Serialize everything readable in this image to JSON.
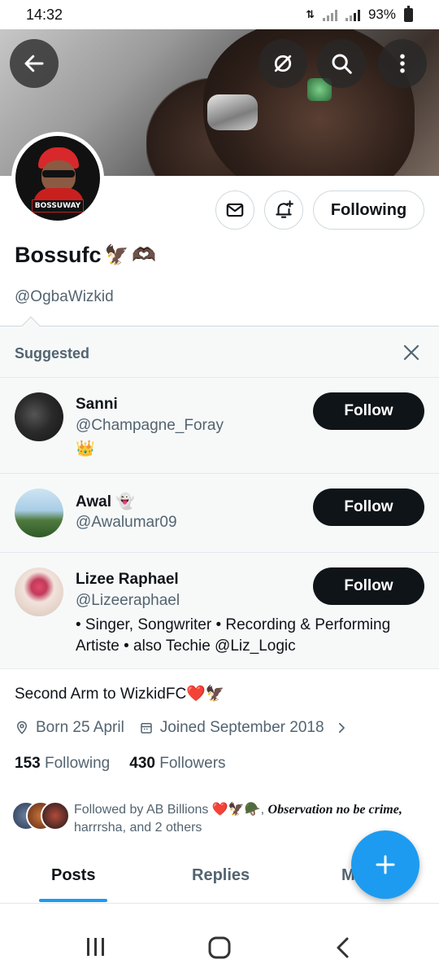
{
  "status_bar": {
    "time": "14:32",
    "battery": "93%",
    "icons": [
      "data-transfer-icon",
      "signal-icon",
      "signal-icon",
      "battery-icon"
    ]
  },
  "banner": {
    "buttons": [
      "back-arrow-icon",
      "hide-icon",
      "search-icon",
      "more-vertical-icon"
    ]
  },
  "profile": {
    "avatar_text": "BOSSUWAY",
    "name": "Bossufc",
    "name_emojis": [
      "🦅",
      "🫶🏿"
    ],
    "handle": "@OgbaWizkid",
    "following_button": "Following",
    "bio": "Second Arm to WizkidFC❤️🦅",
    "born": "Born 25 April",
    "joined": "Joined September 2018",
    "following_count": "153",
    "following_label": "Following",
    "followers_count": "430",
    "followers_label": "Followers",
    "followed_by_prefix": "Followed by AB Billions ❤️🦅🪖,",
    "followed_by_fancy": "Observation no be crime,",
    "followed_by_suffix": "harrrsha, and 2 others"
  },
  "suggested": {
    "title": "Suggested",
    "items": [
      {
        "name": "Sanni",
        "handle": "@Champagne_Foray",
        "bio": "👑",
        "button": "Follow"
      },
      {
        "name": "Awal 👻",
        "handle": "@Awalumar09",
        "bio": "",
        "button": "Follow"
      },
      {
        "name": "Lizee Raphael",
        "handle": "@Lizeeraphael",
        "bio": "• Singer, Songwriter • Recording & Performing Artiste  • also Techie @Liz_Logic",
        "button": "Follow"
      }
    ]
  },
  "tabs": {
    "posts": "Posts",
    "replies": "Replies",
    "media_partial": "M"
  },
  "colors": {
    "accent": "#1d9bf0",
    "text_primary": "#0f1419",
    "text_secondary": "#536471",
    "button_dark": "#0f1419"
  }
}
